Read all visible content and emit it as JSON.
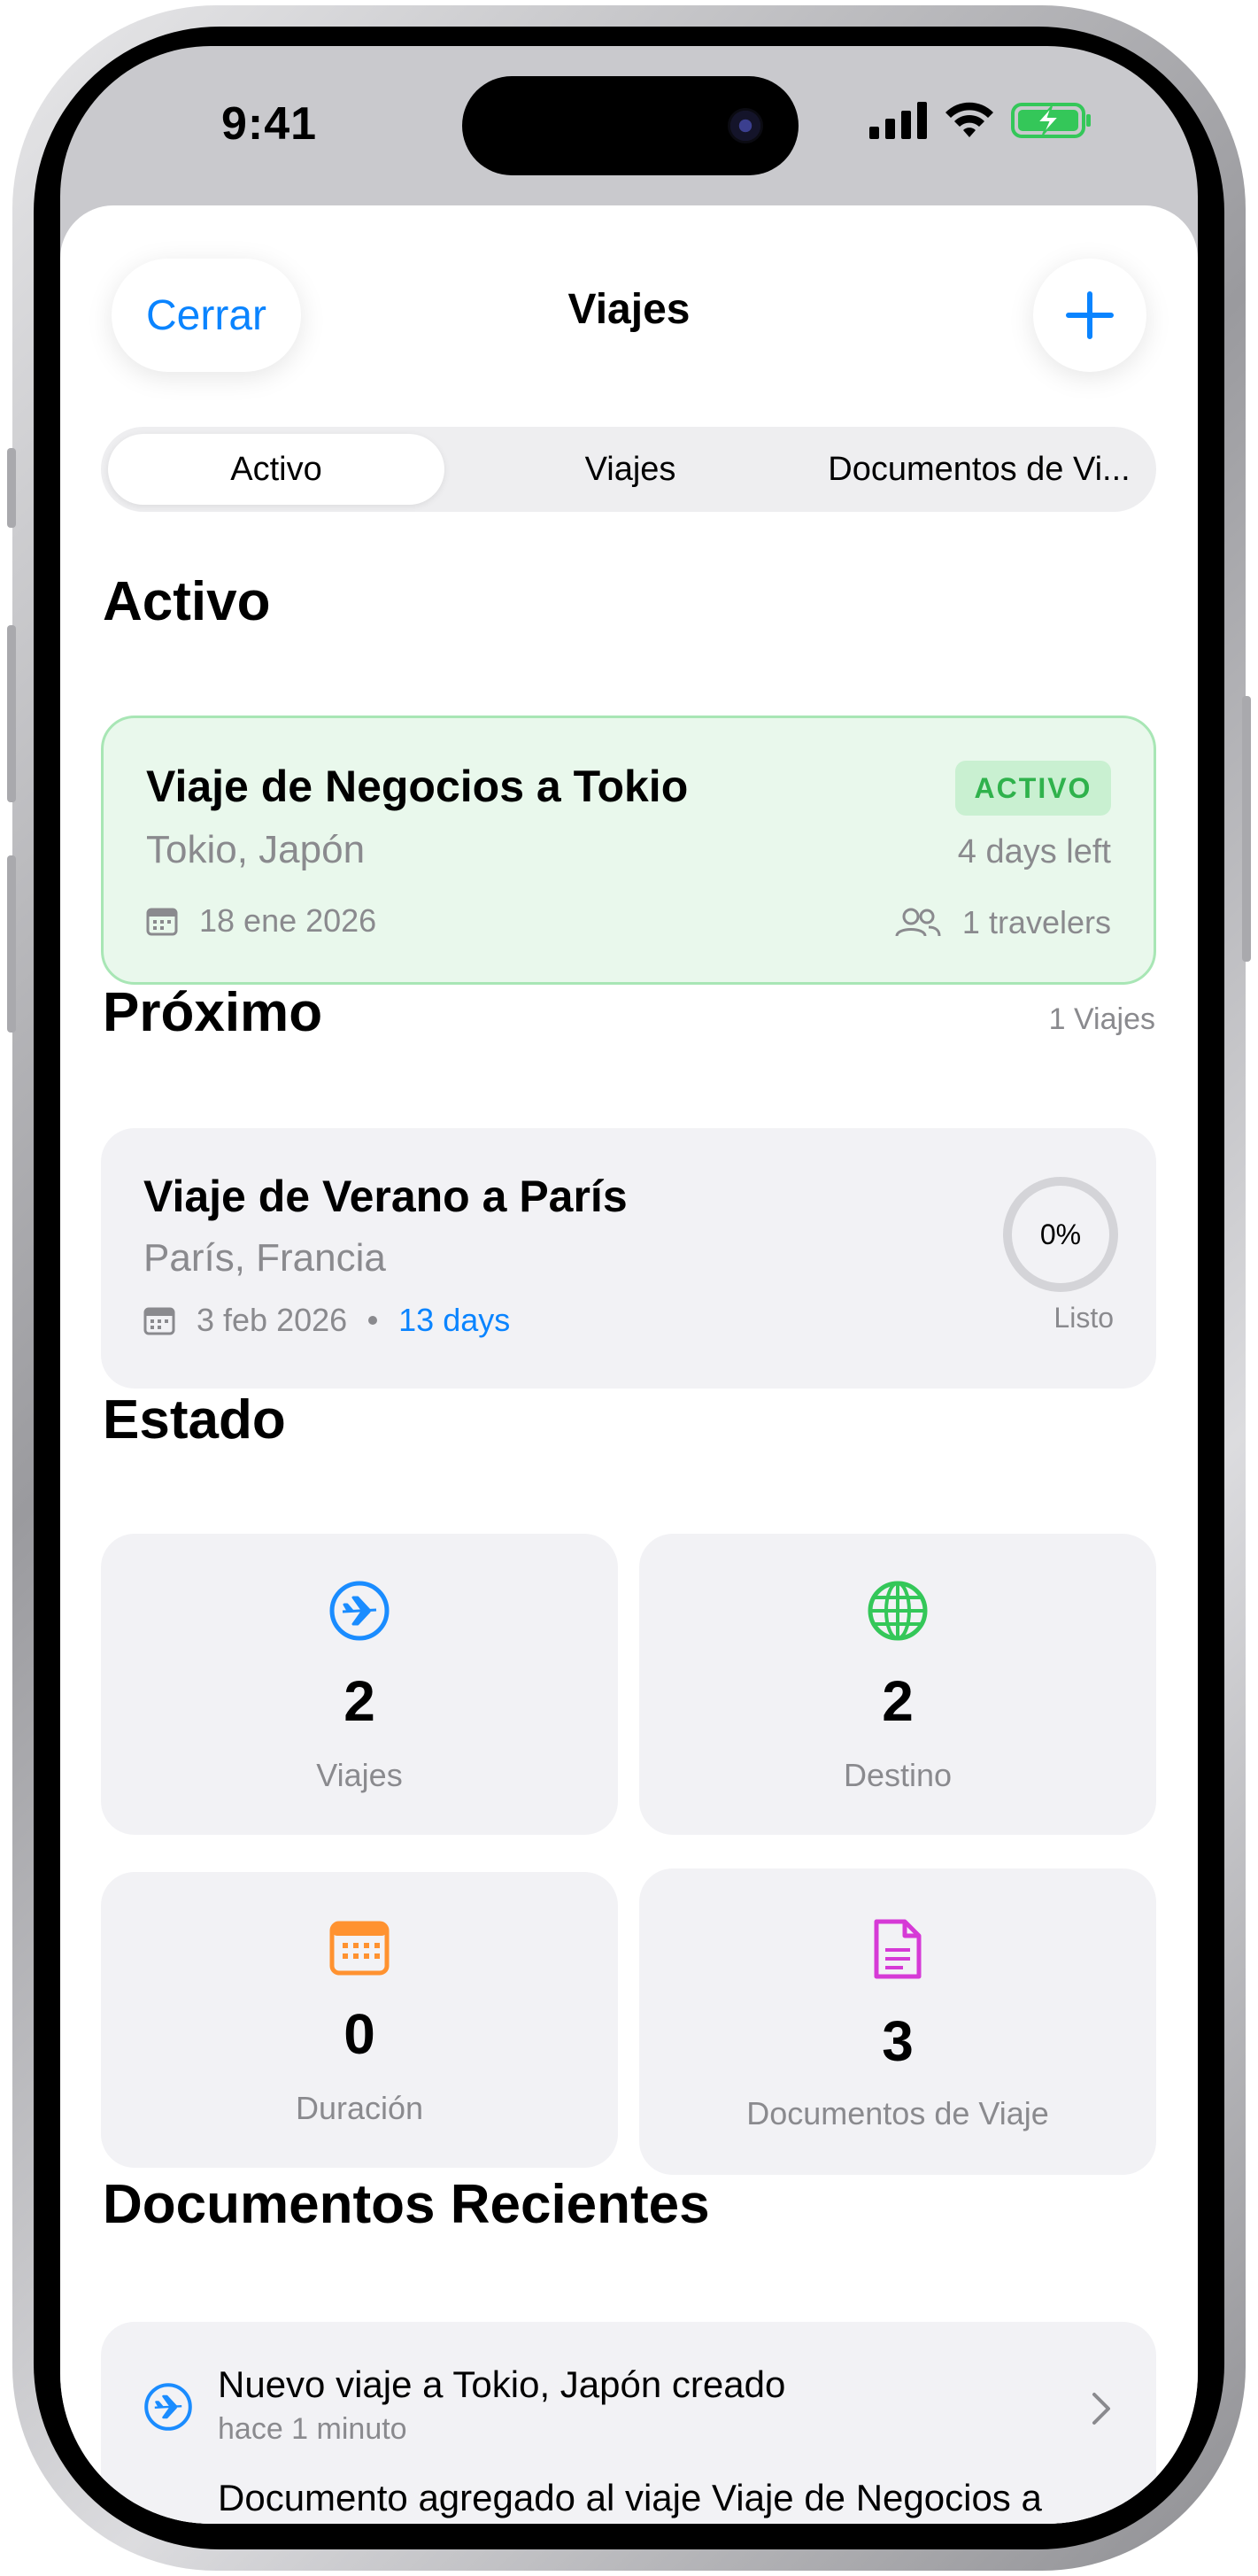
{
  "status_bar": {
    "time": "9:41"
  },
  "nav": {
    "close_label": "Cerrar",
    "title": "Viajes",
    "add_icon": "plus-icon"
  },
  "tabs": [
    {
      "label": "Activo",
      "selected": true
    },
    {
      "label": "Viajes",
      "selected": false
    },
    {
      "label": "Documentos de Vi...",
      "selected": false
    }
  ],
  "active_section": {
    "title": "Activo",
    "trip": {
      "name": "Viaje de Negocios a Tokio",
      "location": "Tokio, Japón",
      "badge": "ACTIVO",
      "days_left": "4 days left",
      "date": "18 ene 2026",
      "travelers": "1 travelers"
    }
  },
  "upcoming_section": {
    "title": "Próximo",
    "count": "1 Viajes",
    "trip": {
      "name": "Viaje de Verano a París",
      "location": "París, Francia",
      "date": "3 feb 2026",
      "days": "13 days",
      "progress_label": "0%",
      "progress_value": 0,
      "status": "Listo"
    }
  },
  "stats_section": {
    "title": "Estado",
    "items": [
      {
        "value": "2",
        "label": "Viajes",
        "icon": "airplane-icon",
        "color": "#1a8cff"
      },
      {
        "value": "2",
        "label": "Destino",
        "icon": "globe-icon",
        "color": "#34c759"
      },
      {
        "value": "0",
        "label": "Duración",
        "icon": "calendar-icon",
        "color": "#ff9230"
      },
      {
        "value": "3",
        "label": "Documentos de Viaje",
        "icon": "document-icon",
        "color": "#d63ad6"
      }
    ]
  },
  "recent_section": {
    "title": "Documentos Recientes",
    "items": [
      {
        "title": "Nuevo viaje a Tokio, Japón creado",
        "time": "hace 1 minuto",
        "icon": "airplane-icon"
      },
      {
        "title": "Documento agregado al viaje Viaje de Negocios a Tokio",
        "time": "",
        "icon": "document-icon"
      }
    ]
  },
  "colors": {
    "accent": "#0a84ff",
    "active_green": "#2fb24c",
    "card_bg": "#f2f2f5",
    "active_card_bg": "#e9f8ec"
  }
}
